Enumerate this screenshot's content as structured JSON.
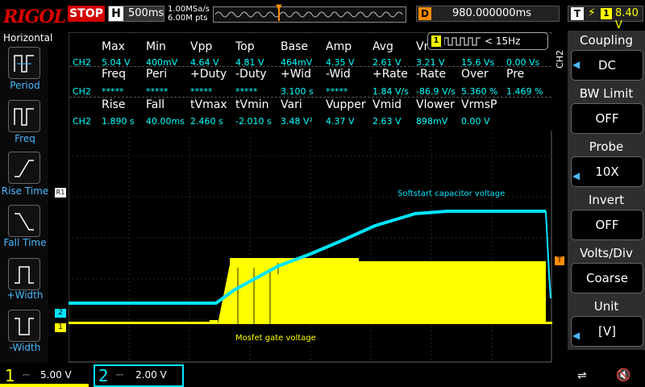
{
  "brand": "RIGOL",
  "topbar": {
    "run_state": "STOP",
    "horizontal_label": "H",
    "timebase": "500ms",
    "sample_rate": "1.00MSa/s",
    "memory_depth": "6.00M pts",
    "delay_label": "D",
    "delay_value": "980.000000ms",
    "trigger_label": "T",
    "trigger_source": "1",
    "trigger_level": "8.40 V"
  },
  "left_panel": {
    "title": "Horizontal",
    "items": [
      {
        "label": "Period"
      },
      {
        "label": "Freq"
      },
      {
        "label": "Rise Time"
      },
      {
        "label": "Fall Time"
      },
      {
        "label": "+Width"
      },
      {
        "label": "-Width"
      }
    ]
  },
  "counter": {
    "channel": "1",
    "value": "< 15Hz"
  },
  "measurements": {
    "row1_headers": [
      "Max",
      "Min",
      "Vpp",
      "Top",
      "Base",
      "Amp",
      "Avg",
      "Vr"
    ],
    "row1_values": [
      "5.04 V",
      "400mV",
      "4.64 V",
      "4.81 V",
      "464mV",
      "4.35 V",
      "2.61 V",
      "3.21 V",
      "15.6 Vs",
      "0.00 Vs"
    ],
    "row2_headers": [
      "Freq",
      "Peri",
      "+Duty",
      "-Duty",
      "+Wid",
      "-Wid",
      "+Rate",
      "-Rate",
      "Over",
      "Pre"
    ],
    "row2_values": [
      "*****",
      "*****",
      "*****",
      "*****",
      "3.100 s",
      "*****",
      "1.84 V/s",
      "-86.9 V/s",
      "5.360 %",
      "1.469 %"
    ],
    "row3_headers": [
      "Rise",
      "Fall",
      "tVmax",
      "tVmin",
      "Vari",
      "Vupper",
      "Vmid",
      "Vlower",
      "VrmsP"
    ],
    "row3_values": [
      "1.890 s",
      "40.00ms",
      "2.460 s",
      "-2.010 s",
      "3.48 V²",
      "4.37 V",
      "2.63 V",
      "898mV",
      "0.00 V"
    ],
    "channel_label": "CH2"
  },
  "annotations": {
    "cap": "Softstart capacitor voltage",
    "gate": "Mosfet gate voltage"
  },
  "markers": {
    "ref": "R1",
    "ch2": "2",
    "ch1": "1",
    "trig": "T"
  },
  "right_panel": {
    "channel": "CH2",
    "sections": [
      {
        "title": "Coupling",
        "value": "DC"
      },
      {
        "title": "BW Limit",
        "value": "OFF"
      },
      {
        "title": "Probe",
        "value": "10X"
      },
      {
        "title": "Invert",
        "value": "OFF"
      },
      {
        "title": "Volts/Div",
        "value": "Coarse"
      },
      {
        "title": "Unit",
        "value": "[V]"
      }
    ]
  },
  "bottom": {
    "ch1_num": "1",
    "ch1_scale": "5.00 V",
    "ch2_num": "2",
    "ch2_scale": "2.00 V"
  },
  "colors": {
    "ch1": "#ffff00",
    "ch2": "#00e5ff",
    "accent": "#ff8c00",
    "panel_gray": "#2e2e2e"
  }
}
